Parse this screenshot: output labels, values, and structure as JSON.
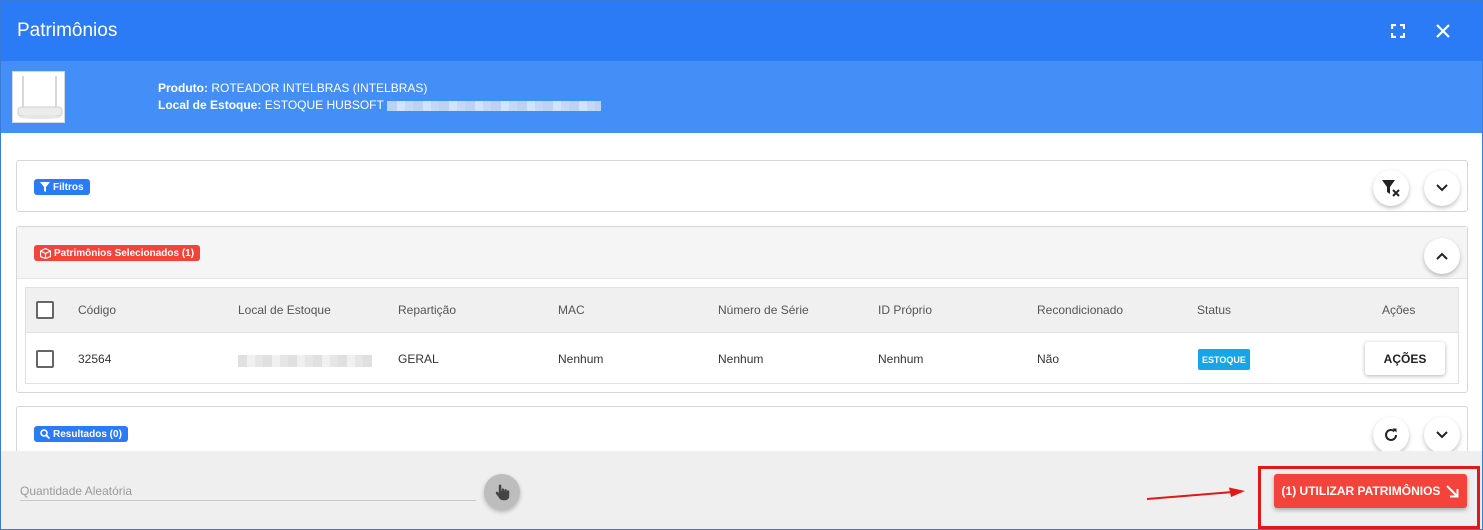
{
  "dialog": {
    "title": "Patrimônios"
  },
  "product": {
    "produto_label": "Produto:",
    "produto_value": "ROTEADOR INTELBRAS (INTELBRAS)",
    "local_label": "Local de Estoque:",
    "local_value": "ESTOQUE HUBSOFT"
  },
  "filters": {
    "badge": "Filtros"
  },
  "selected": {
    "badge": "Patrimônios Selecionados (1)",
    "columns": [
      "Código",
      "Local de Estoque",
      "Repartição",
      "MAC",
      "Número de Série",
      "ID Próprio",
      "Recondicionado",
      "Status",
      "Ações"
    ],
    "rows": [
      {
        "codigo": "32564",
        "reparticao": "GERAL",
        "mac": "Nenhum",
        "serie": "Nenhum",
        "id_proprio": "Nenhum",
        "recondicionado": "Não",
        "status": "ESTOQUE",
        "acoes": "AÇÕES"
      }
    ]
  },
  "results": {
    "badge": "Resultados (0)"
  },
  "footer": {
    "quantity_placeholder": "Quantidade Aleatória",
    "use_button": "(1) UTILIZAR PATRIMÔNIOS"
  },
  "colors": {
    "header": "#2b7bf6",
    "subheader": "#448ef8",
    "danger": "#f4433a",
    "status": "#16a6e8",
    "highlight": "#e01818"
  }
}
